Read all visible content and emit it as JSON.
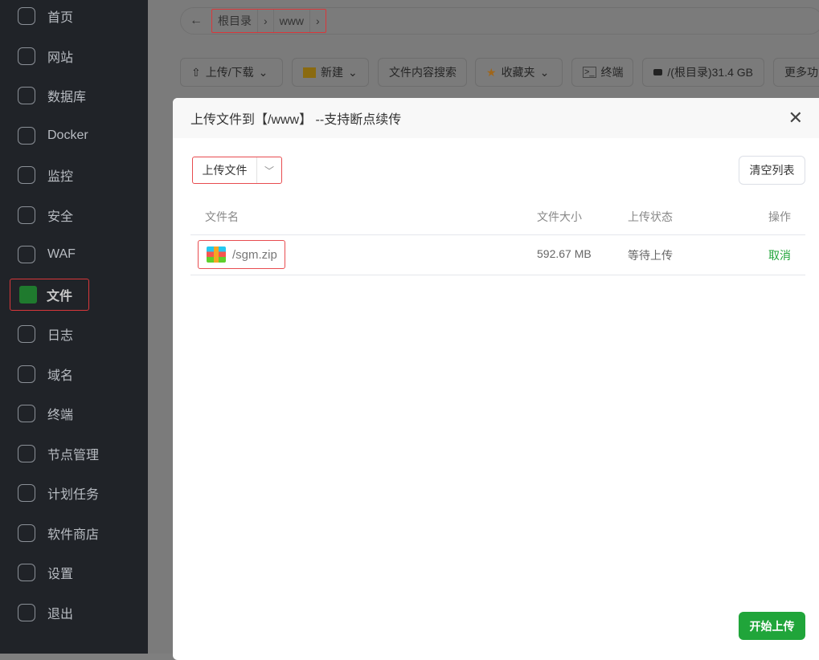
{
  "sidebar": {
    "items": [
      {
        "label": "首页",
        "icon": "home-icon"
      },
      {
        "label": "网站",
        "icon": "website-icon"
      },
      {
        "label": "数据库",
        "icon": "database-icon"
      },
      {
        "label": "Docker",
        "icon": "docker-icon"
      },
      {
        "label": "监控",
        "icon": "monitor-icon"
      },
      {
        "label": "安全",
        "icon": "shield-icon"
      },
      {
        "label": "WAF",
        "icon": "globe-icon"
      },
      {
        "label": "文件",
        "icon": "folder-icon"
      },
      {
        "label": "日志",
        "icon": "log-icon"
      },
      {
        "label": "域名",
        "icon": "www-icon"
      },
      {
        "label": "终端",
        "icon": "terminal-icon"
      },
      {
        "label": "节点管理",
        "icon": "node-icon"
      },
      {
        "label": "计划任务",
        "icon": "calendar-icon"
      },
      {
        "label": "软件商店",
        "icon": "apps-icon"
      },
      {
        "label": "设置",
        "icon": "settings-icon"
      },
      {
        "label": "退出",
        "icon": "logout-icon"
      }
    ]
  },
  "breadcrumb": [
    "根目录",
    "www"
  ],
  "toolbar": {
    "upload_download": "上传/下载",
    "new": "新建",
    "content_search": "文件内容搜索",
    "favorites": "收藏夹",
    "terminal": "终端",
    "disk": "/(根目录)31.4 GB",
    "more": "更多功能"
  },
  "modal": {
    "title": "上传文件到【/www】 --支持断点续传",
    "upload_files": "上传文件",
    "clear_list": "清空列表",
    "columns": [
      "文件名",
      "文件大小",
      "上传状态",
      "操作"
    ],
    "rows": [
      {
        "name": "/sgm.zip",
        "size": "592.67 MB",
        "status": "等待上传",
        "action": "取消"
      }
    ],
    "start_upload": "开始上传"
  },
  "colors": {
    "accent": "#20a53a",
    "highlight": "#e84c4f"
  }
}
